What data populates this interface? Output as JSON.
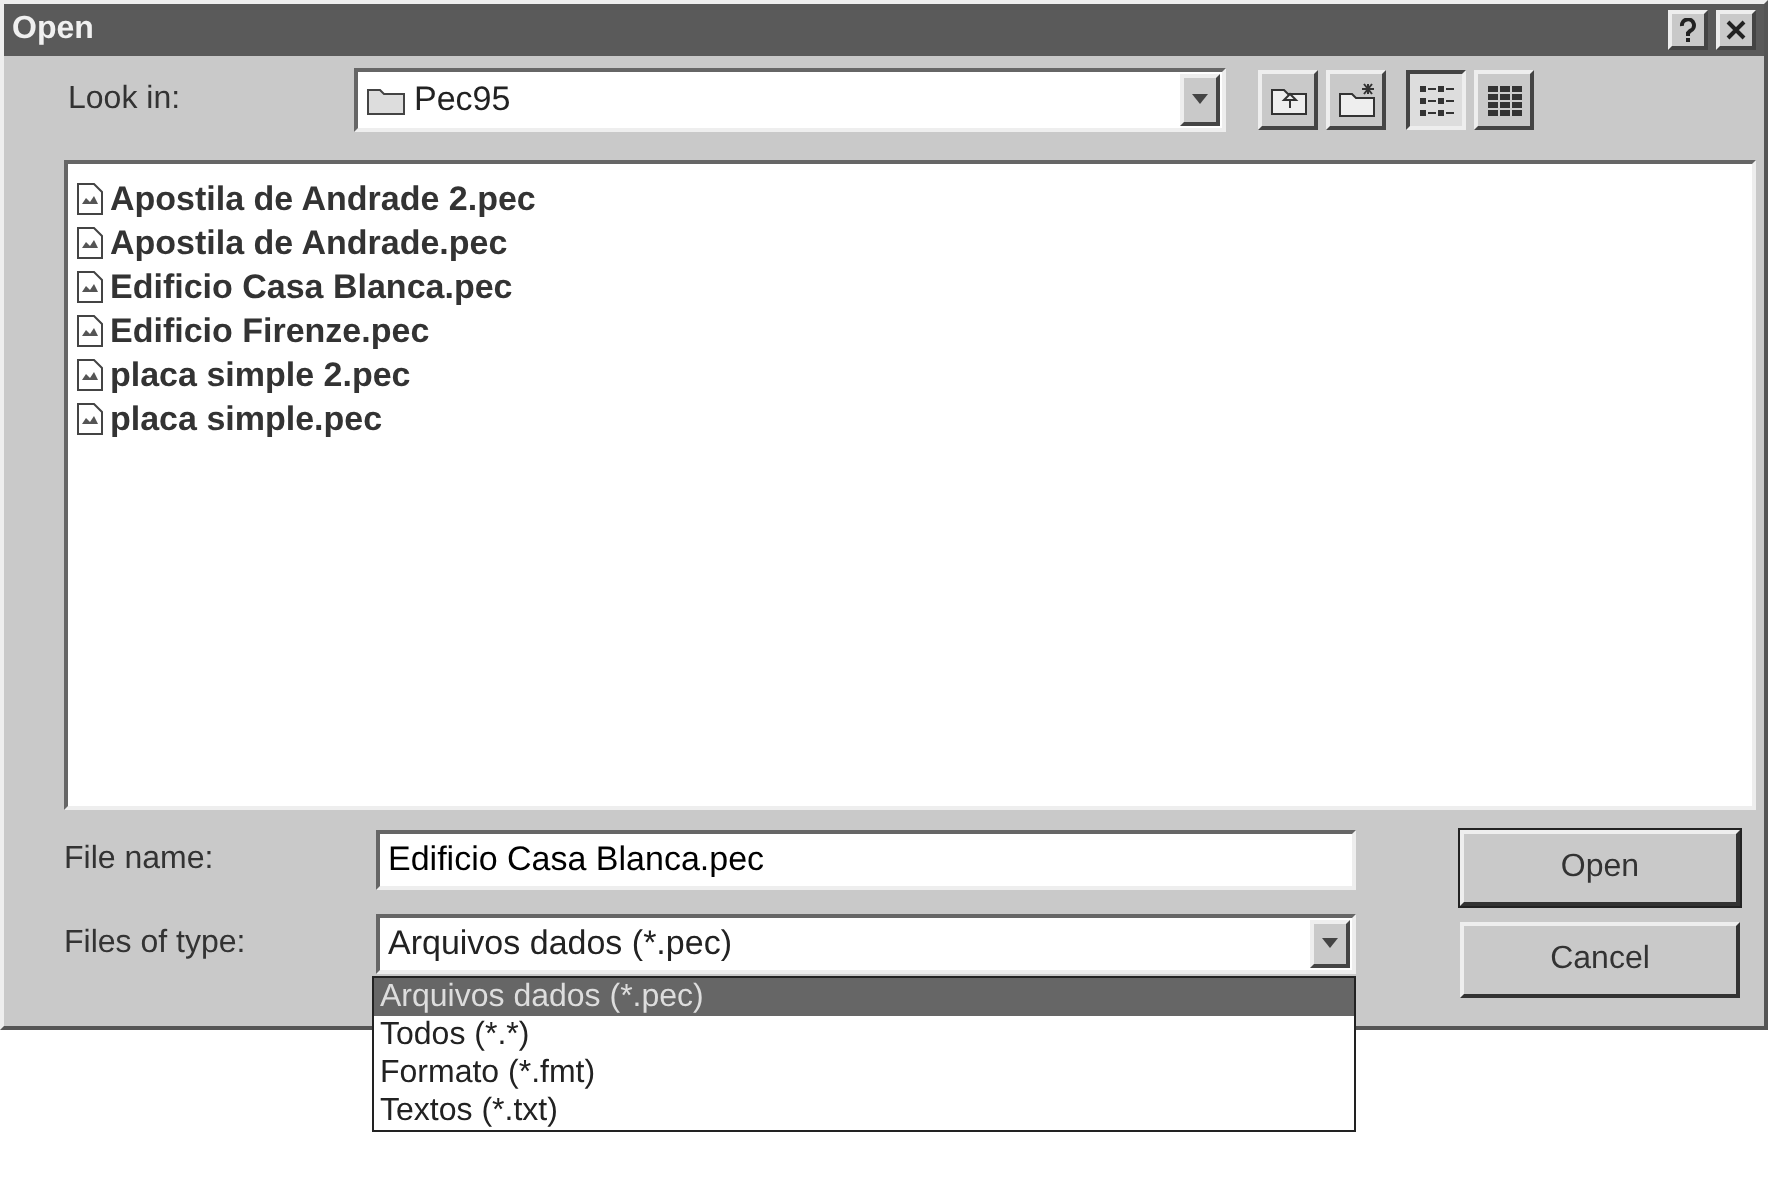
{
  "window": {
    "title": "Open"
  },
  "look_in": {
    "label": "Look in:",
    "value": "Pec95"
  },
  "toolbar": [
    {
      "kind": "up-folder",
      "pressed": false
    },
    {
      "kind": "new-folder",
      "pressed": false
    },
    {
      "kind": "list",
      "pressed": true
    },
    {
      "kind": "details",
      "pressed": false
    }
  ],
  "files": [
    {
      "name": "Apostila de Andrade 2.pec"
    },
    {
      "name": "Apostila de Andrade.pec"
    },
    {
      "name": "Edificio Casa Blanca.pec"
    },
    {
      "name": "Edificio Firenze.pec"
    },
    {
      "name": "placa simple 2.pec"
    },
    {
      "name": "placa simple.pec"
    }
  ],
  "file_name": {
    "label": "File name:",
    "value": "Edificio Casa Blanca.pec"
  },
  "file_type": {
    "label": "Files of type:",
    "value": "Arquivos dados (*.pec)",
    "expanded": true,
    "options": [
      {
        "label": "Arquivos dados (*.pec)",
        "selected": true
      },
      {
        "label": "Todos (*.*)",
        "selected": false
      },
      {
        "label": "Formato (*.fmt)",
        "selected": false
      },
      {
        "label": "Textos (*.txt)",
        "selected": false
      }
    ]
  },
  "buttons": [
    "Open",
    "Cancel"
  ]
}
